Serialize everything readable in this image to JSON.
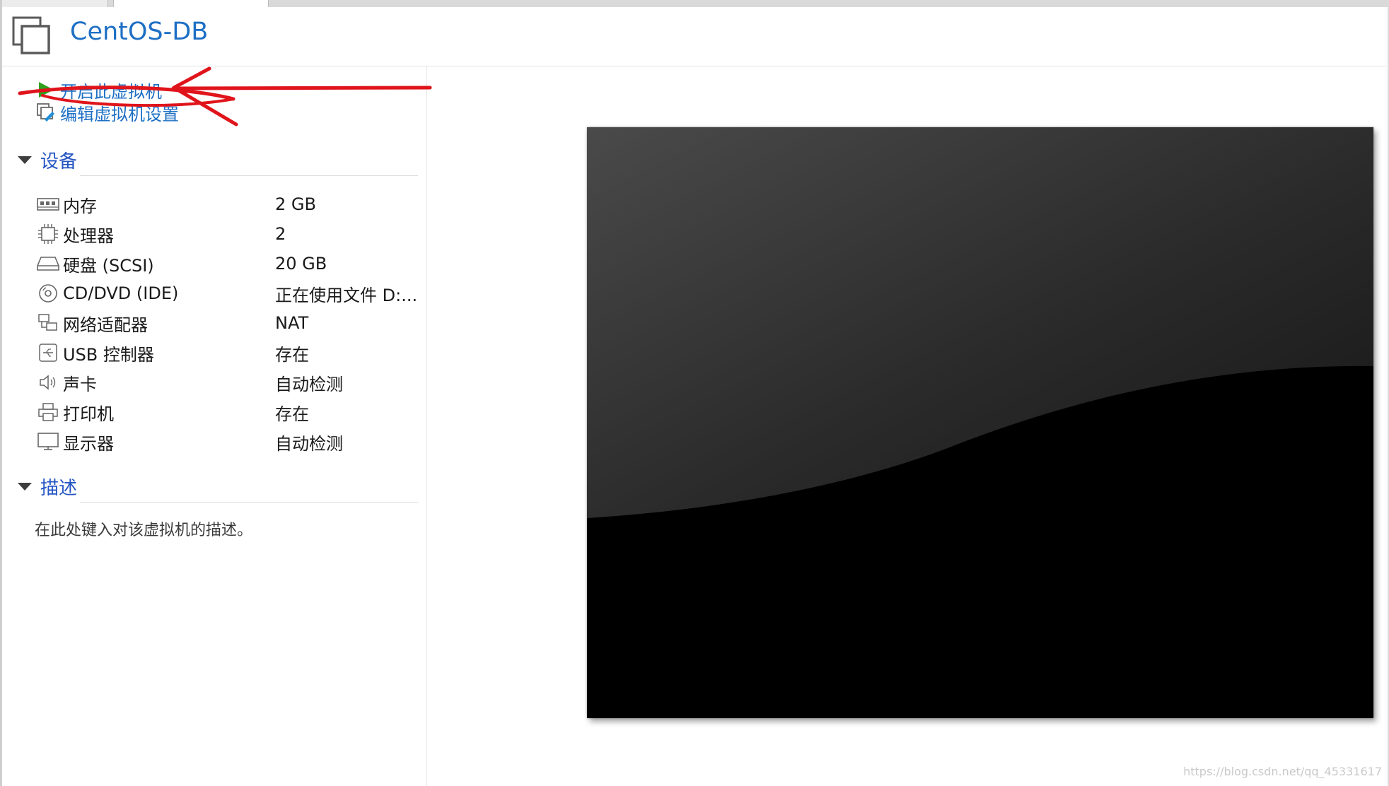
{
  "header": {
    "title": "CentOS-DB"
  },
  "actions": {
    "power_on": "开启此虚拟机",
    "edit_settings": "编辑虚拟机设置"
  },
  "devices": {
    "heading": "设备",
    "items": [
      {
        "name": "内存",
        "value": "2 GB",
        "icon": "memory-icon"
      },
      {
        "name": "处理器",
        "value": "2",
        "icon": "processor-icon"
      },
      {
        "name": "硬盘 (SCSI)",
        "value": "20 GB",
        "icon": "hard-disk-icon"
      },
      {
        "name": "CD/DVD (IDE)",
        "value": "正在使用文件 D:...",
        "icon": "cd-dvd-icon"
      },
      {
        "name": "网络适配器",
        "value": "NAT",
        "icon": "network-adapter-icon"
      },
      {
        "name": "USB 控制器",
        "value": "存在",
        "icon": "usb-icon"
      },
      {
        "name": "声卡",
        "value": "自动检测",
        "icon": "sound-icon"
      },
      {
        "name": "打印机",
        "value": "存在",
        "icon": "printer-icon"
      },
      {
        "name": "显示器",
        "value": "自动检测",
        "icon": "display-icon"
      }
    ]
  },
  "description": {
    "heading": "描述",
    "placeholder": "在此处键入对该虚拟机的描述。"
  },
  "watermark": "https://blog.csdn.net/qq_45331617",
  "colors": {
    "link": "#1d6fc4",
    "section": "#2455c3",
    "annotation": "#e0141b",
    "play": "#2ea01e"
  }
}
